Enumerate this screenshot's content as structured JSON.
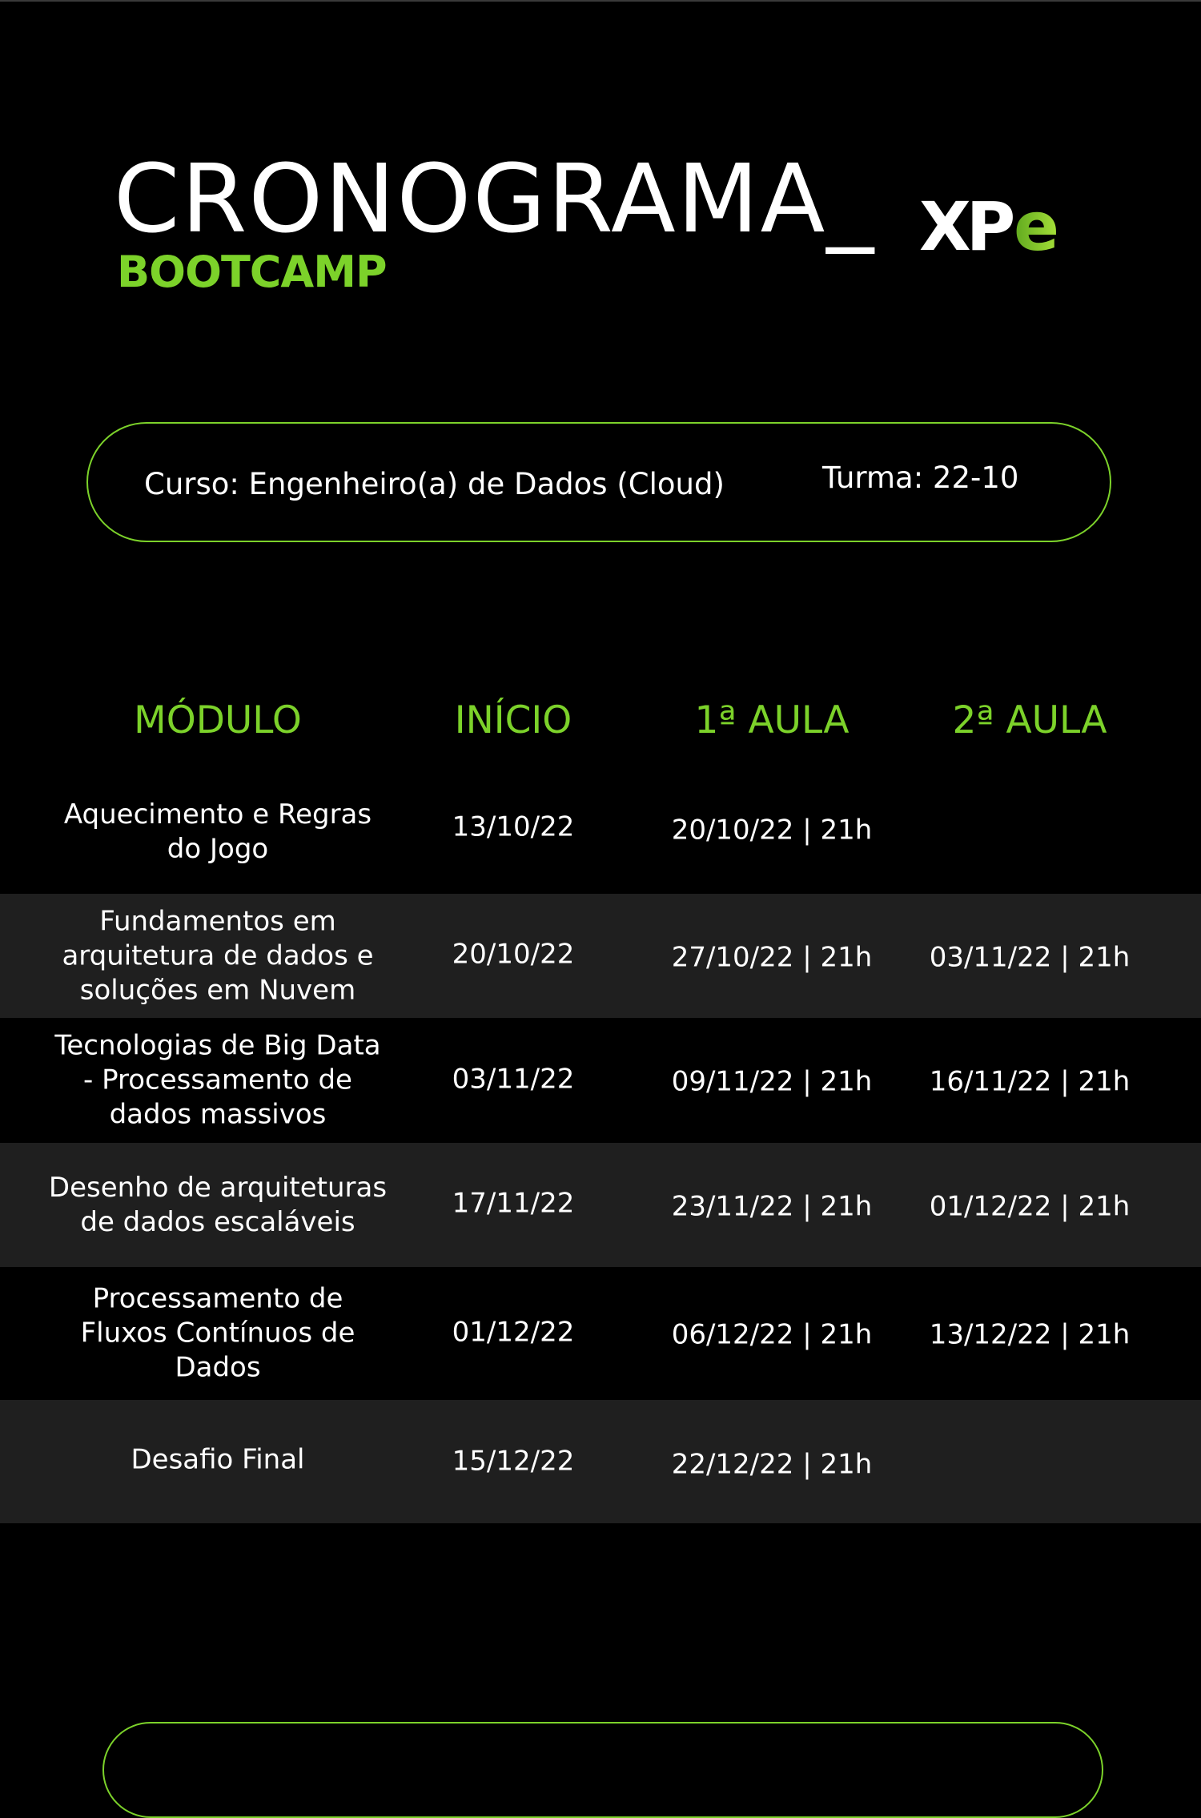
{
  "header": {
    "title": "CRONOGRAMA_",
    "subtitle": "BOOTCAMP",
    "logo_text": "XPe"
  },
  "info": {
    "course": "Curso: Engenheiro(a) de Dados (Cloud)",
    "class": "Turma: 22-10"
  },
  "table": {
    "headers": [
      "MÓDULO",
      "INÍCIO",
      "1ª AULA",
      "2ª AULA"
    ],
    "rows": [
      {
        "module": "Aquecimento e Regras do Jogo",
        "start": "13/10/22",
        "class1": "20/10/22 | 21h",
        "class2": ""
      },
      {
        "module": "Fundamentos em arquitetura de dados e soluções em Nuvem",
        "start": "20/10/22",
        "class1": "27/10/22 | 21h",
        "class2": "03/11/22 | 21h"
      },
      {
        "module": "Tecnologias de Big Data - Processamento de dados massivos",
        "start": "03/11/22",
        "class1": "09/11/22 | 21h",
        "class2": "16/11/22 | 21h"
      },
      {
        "module": "Desenho de arquiteturas de dados escaláveis",
        "start": "17/11/22",
        "class1": "23/11/22 | 21h",
        "class2": "01/12/22 | 21h"
      },
      {
        "module": "Processamento de Fluxos Contínuos de Dados",
        "start": "01/12/22",
        "class1": "06/12/22 | 21h",
        "class2": "13/12/22 | 21h"
      },
      {
        "module": "Desafio Final",
        "start": "15/12/22",
        "class1": "22/12/22 | 21h",
        "class2": ""
      }
    ]
  },
  "colors": {
    "background": "#000000",
    "accent_green": "#7cd22a",
    "row_alt": "#1f1f1f",
    "text": "#ffffff"
  }
}
